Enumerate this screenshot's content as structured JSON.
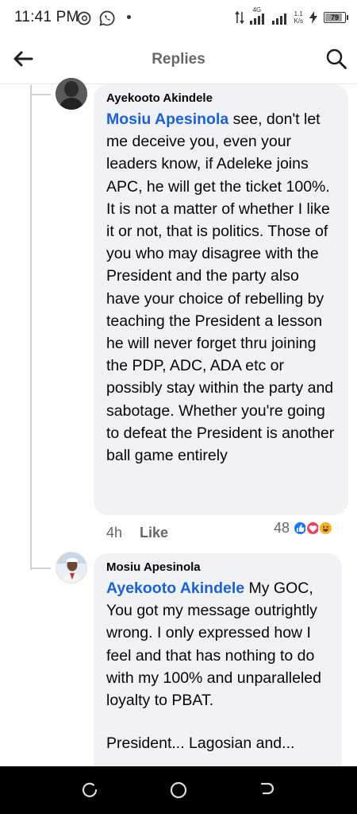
{
  "status_bar": {
    "time": "11:41 PM",
    "network_label": "4G",
    "speed_value": "1.1",
    "speed_unit": "K/s",
    "battery_level": "79"
  },
  "header": {
    "title": "Replies",
    "back_icon": "back-arrow-icon",
    "search_icon": "search-icon"
  },
  "comments": [
    {
      "author": "Ayekooto Akindele",
      "mention": "Mosiu Apesinola",
      "text": " see, don't let me deceive you, even your leaders know, if Adeleke joins APC, he will get the ticket 100%. It is not a matter of whether I like it or not, that is politics. Those of you who may disagree with the President and the party also have your choice of rebelling by teaching the President a lesson he will never forget thru joining the PDP, ADC, ADA etc or possibly stay within the party and sabotage. Whether you're going to defeat the President is another ball game entirely",
      "time": "4h",
      "like_label": "Like",
      "reaction_count": "48",
      "reactions": [
        "like",
        "love",
        "haha"
      ]
    },
    {
      "author": "Mosiu Apesinola",
      "mention": "Ayekooto Akindele",
      "text": " My GOC, You got my message outrightly wrong. I only expressed how I feel and that has nothing to do with my 100% and unparalleled loyalty to PBAT.",
      "partial_text": "President... Lagosian and..."
    }
  ],
  "nav": {
    "recents_icon": "recent-apps-icon",
    "home_icon": "home-circle-icon",
    "back_icon": "back-nav-icon"
  },
  "colors": {
    "mention": "#1b62d2",
    "bubble": "#f0f2f5",
    "like_reaction": "#1877f2",
    "love_reaction": "#f33e58",
    "haha_reaction": "#f7b125"
  }
}
